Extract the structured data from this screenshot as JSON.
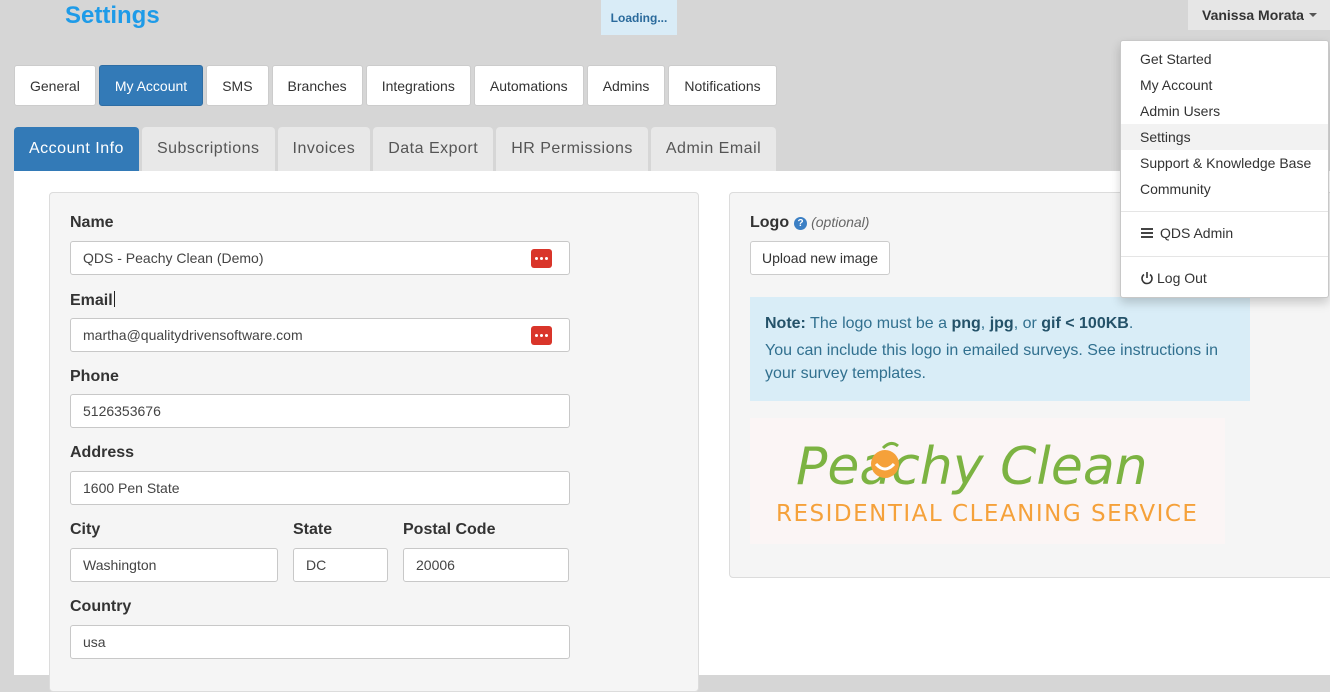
{
  "header": {
    "title": "Settings",
    "loading_text": "Loading...",
    "user_name": "Vanissa Morata"
  },
  "user_menu": {
    "items": [
      "Get Started",
      "My Account",
      "Admin Users",
      "Settings",
      "Support & Knowledge Base",
      "Community"
    ],
    "active_item": "Settings",
    "admin_label": "QDS Admin",
    "logout_label": "Log Out"
  },
  "main_tabs": [
    "General",
    "My Account",
    "SMS",
    "Branches",
    "Integrations",
    "Automations",
    "Admins",
    "Notifications"
  ],
  "main_tab_active": "My Account",
  "sub_tabs": [
    "Account Info",
    "Subscriptions",
    "Invoices",
    "Data Export",
    "HR Permissions",
    "Admin Email"
  ],
  "sub_tab_active": "Account Info",
  "account": {
    "name_label": "Name",
    "name_value": "QDS - Peachy Clean (Demo)",
    "email_label": "Email",
    "email_value": "martha@qualitydrivensoftware.com",
    "phone_label": "Phone",
    "phone_value": "5126353676",
    "address_label": "Address",
    "address_value": "1600 Pen State",
    "city_label": "City",
    "city_value": "Washington",
    "state_label": "State",
    "state_value": "DC",
    "postal_label": "Postal Code",
    "postal_value": "20006",
    "country_label": "Country",
    "country_value": "usa"
  },
  "logo": {
    "label": "Logo",
    "optional": "(optional)",
    "upload_button": "Upload new image",
    "note_label": "Note:",
    "note_text_1": " The logo must be a ",
    "note_png": "png",
    "note_sep_1": ", ",
    "note_jpg": "jpg",
    "note_sep_2": ", or ",
    "note_gif": "gif < 100KB",
    "note_end": ".",
    "note_text_2": "You can include this logo in emailed surveys. See instructions in your survey templates.",
    "brand_line_1": "Peachy Clean",
    "brand_line_2": "RESIDENTIAL CLEANING SERVICE",
    "brand_green": "#7cb342",
    "brand_orange": "#f5a13a"
  },
  "colors": {
    "title_blue": "#1e9be8",
    "active_tab": "#337ab7",
    "password_icon_red": "#d9352a"
  }
}
